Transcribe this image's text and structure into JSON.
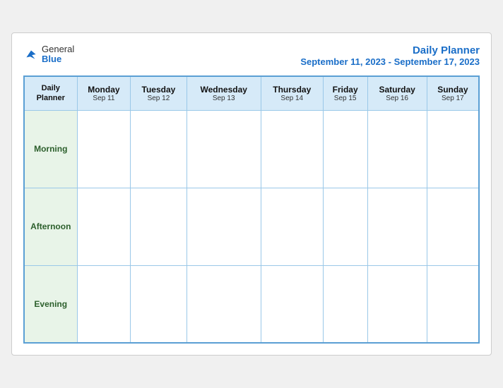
{
  "header": {
    "logo_general": "General",
    "logo_blue": "Blue",
    "title_main": "Daily Planner",
    "title_dates": "September 11, 2023 - September 17, 2023"
  },
  "columns": [
    {
      "label": "Daily\nPlanner",
      "sub": "",
      "is_first": true
    },
    {
      "label": "Monday",
      "sub": "Sep 11"
    },
    {
      "label": "Tuesday",
      "sub": "Sep 12"
    },
    {
      "label": "Wednesday",
      "sub": "Sep 13"
    },
    {
      "label": "Thursday",
      "sub": "Sep 14"
    },
    {
      "label": "Friday",
      "sub": "Sep 15"
    },
    {
      "label": "Saturday",
      "sub": "Sep 16"
    },
    {
      "label": "Sunday",
      "sub": "Sep 17"
    }
  ],
  "rows": [
    {
      "label": "Morning"
    },
    {
      "label": "Afternoon"
    },
    {
      "label": "Evening"
    }
  ]
}
